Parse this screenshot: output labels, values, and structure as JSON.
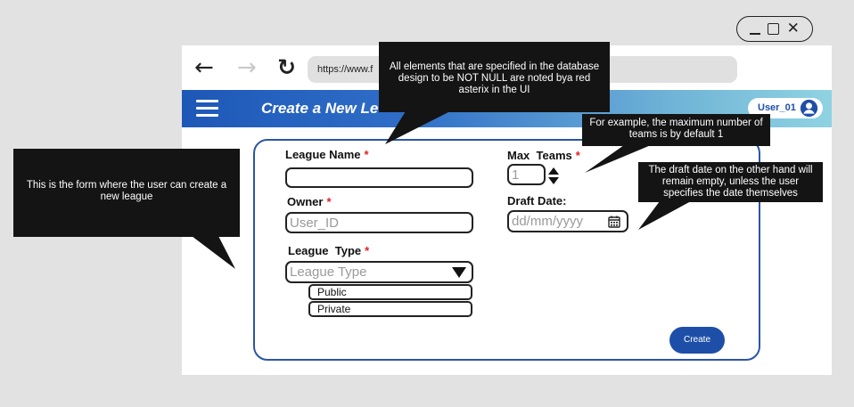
{
  "browser": {
    "url": "https://www.f",
    "window_controls": {
      "minimize_icon": "minimize-icon",
      "maximize_icon": "maximize-icon",
      "close_icon": "close-icon"
    },
    "nav_icons": {
      "back": "back-arrow-icon",
      "forward": "forward-arrow-icon",
      "reload": "reload-icon"
    }
  },
  "appbar": {
    "menu_icon": "hamburger-menu-icon",
    "title": "Create a New Le",
    "user_name": "User_01",
    "user_icon": "user-avatar-icon"
  },
  "form": {
    "league_name": {
      "label": "League Name",
      "required": "*",
      "value": ""
    },
    "owner": {
      "label": "Owner",
      "required": "*",
      "placeholder": "User_ID"
    },
    "league_type": {
      "label": "League  Type",
      "required": "*",
      "placeholder": "League Type",
      "options": [
        "Public",
        "Private"
      ]
    },
    "max_teams": {
      "label": "Max  Teams",
      "required": "*",
      "value": "1"
    },
    "draft_date": {
      "label": "Draft Date:",
      "placeholder": "dd/mm/yyyy",
      "icon": "calendar-icon"
    },
    "create_button": "Create"
  },
  "callouts": {
    "not_null": "All elements that are specified in the database design to be NOT NULL are noted bya red asterix in the UI",
    "max_teams_default": "For example, the maximum number of teams is by default 1",
    "draft_date_empty": "The draft date on the other hand will remain empty, unless the user specifies the date themselves",
    "form_description": "This is the form where the user can create a new league"
  },
  "colors": {
    "accent_blue": "#1e4fa8",
    "required_red": "#e0201f",
    "callout_bg": "#141414"
  }
}
